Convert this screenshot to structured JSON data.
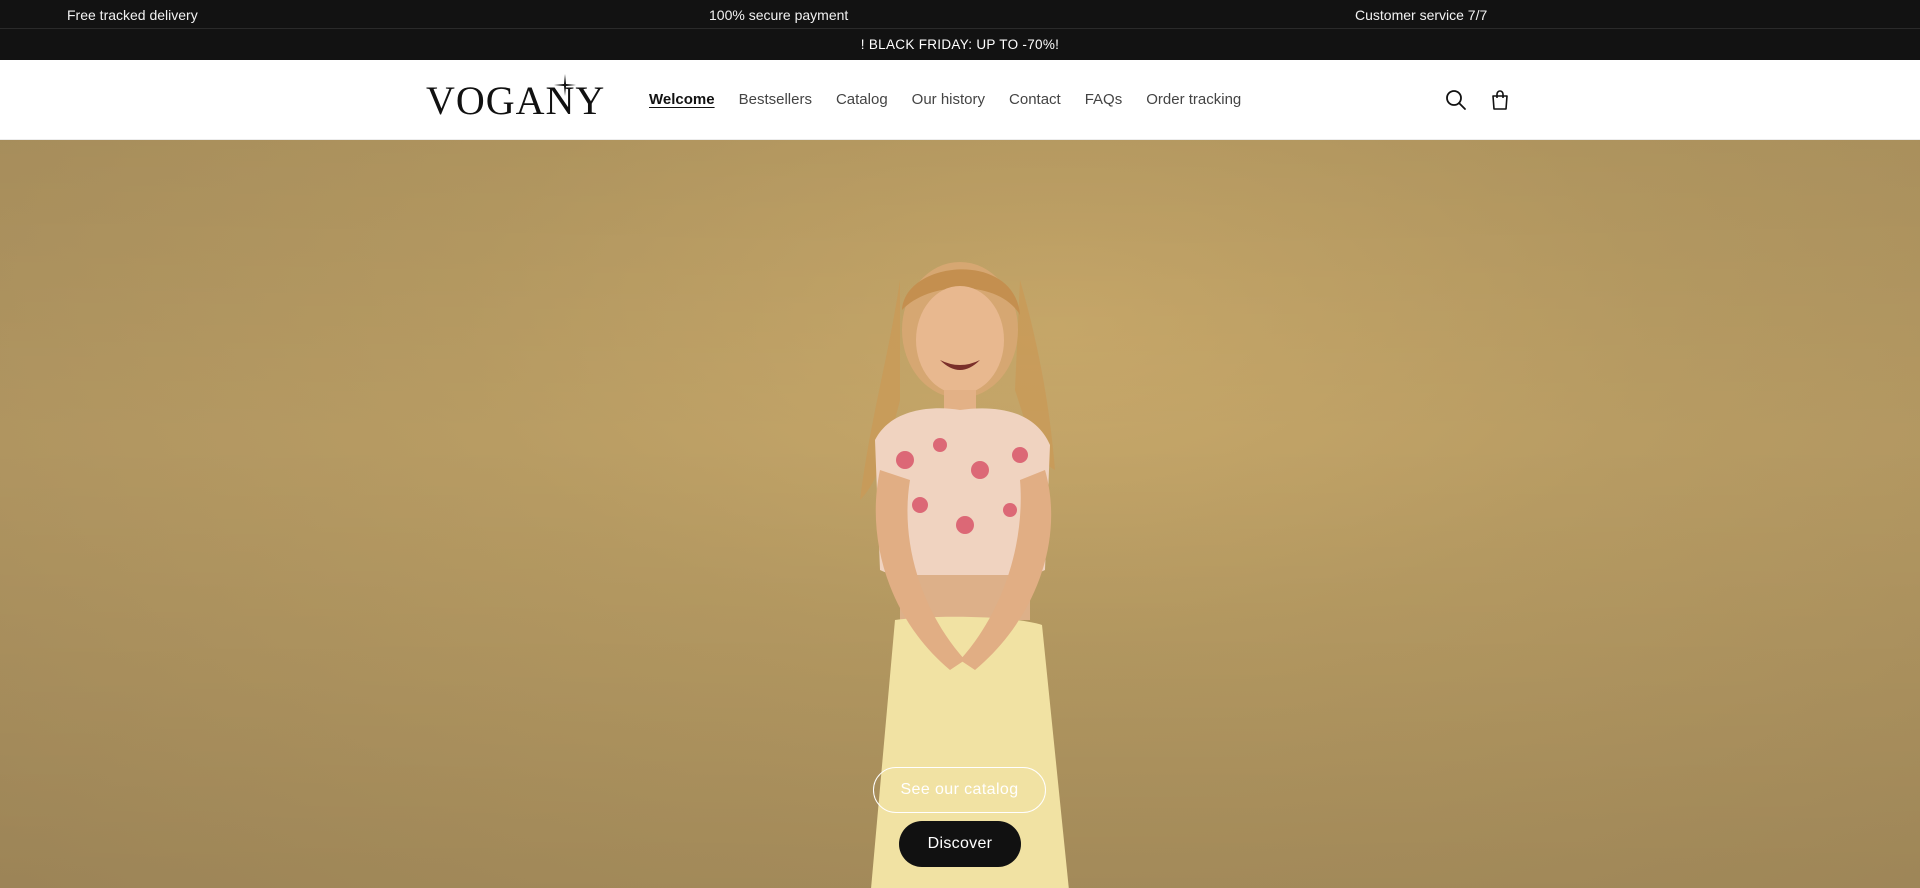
{
  "topbar": {
    "left": "Free tracked delivery",
    "center": "100% secure payment",
    "right": "Customer service 7/7"
  },
  "announcement": "! BLACK FRIDAY: UP TO -70%!",
  "header": {
    "logo": "VOGANY",
    "nav": [
      {
        "label": "Welcome",
        "active": true
      },
      {
        "label": "Bestsellers"
      },
      {
        "label": "Catalog"
      },
      {
        "label": "Our history"
      },
      {
        "label": "Contact"
      },
      {
        "label": "FAQs"
      },
      {
        "label": "Order tracking"
      }
    ],
    "icons": [
      "search-icon",
      "shopping-bag-icon"
    ]
  },
  "hero": {
    "primary_cta": "See our catalog",
    "secondary_cta": "Discover",
    "background_color": "#b89c63"
  },
  "colors": {
    "bar_bg": "#121212",
    "text_dark": "#111111",
    "button_dark": "#111111"
  }
}
